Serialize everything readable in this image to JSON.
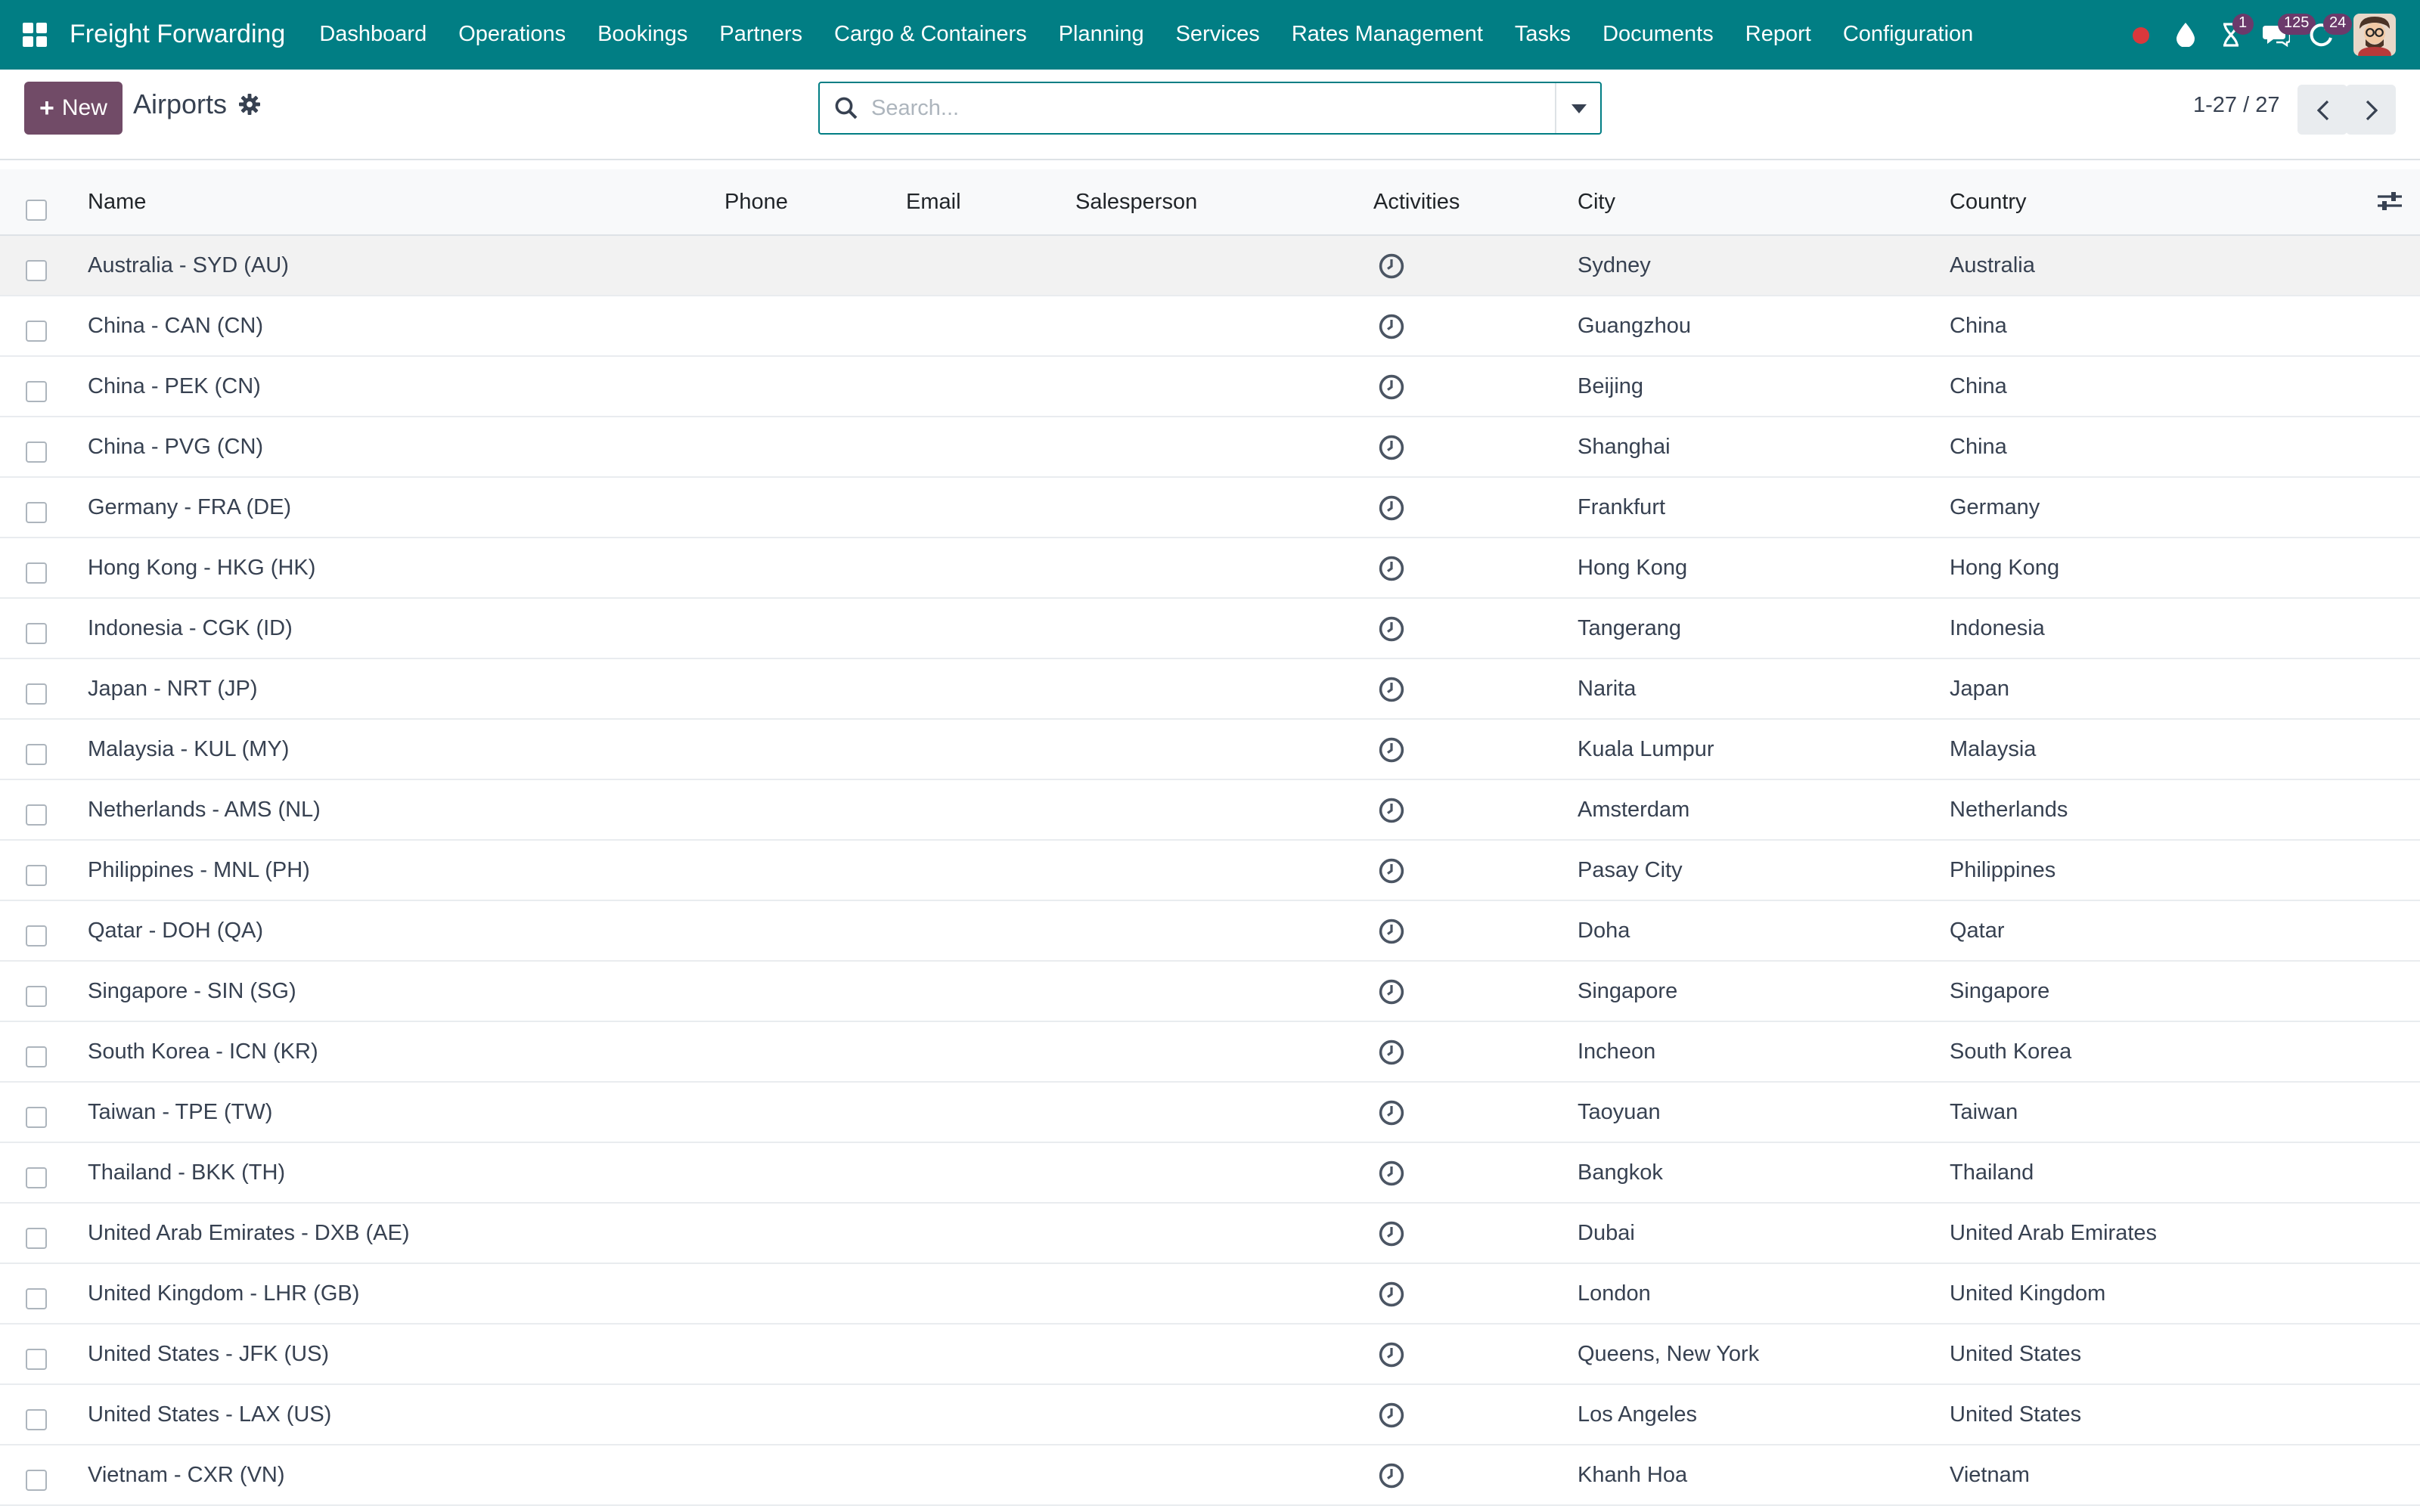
{
  "navbar": {
    "brand": "Freight Forwarding",
    "menu": [
      "Dashboard",
      "Operations",
      "Bookings",
      "Partners",
      "Cargo & Containers",
      "Planning",
      "Services",
      "Rates Management",
      "Tasks",
      "Documents",
      "Report",
      "Configuration"
    ],
    "badges": {
      "activities": "1",
      "messages": "125",
      "updates": "24"
    }
  },
  "control_panel": {
    "new_label": "New",
    "title": "Airports",
    "search_placeholder": "Search...",
    "pager": "1-27 / 27"
  },
  "table": {
    "headers": {
      "name": "Name",
      "phone": "Phone",
      "email": "Email",
      "salesperson": "Salesperson",
      "activities": "Activities",
      "city": "City",
      "country": "Country"
    },
    "rows": [
      {
        "name": "Australia - SYD (AU)",
        "phone": "",
        "email": "",
        "salesperson": "",
        "city": "Sydney",
        "country": "Australia"
      },
      {
        "name": "China - CAN (CN)",
        "phone": "",
        "email": "",
        "salesperson": "",
        "city": "Guangzhou",
        "country": "China"
      },
      {
        "name": "China - PEK (CN)",
        "phone": "",
        "email": "",
        "salesperson": "",
        "city": "Beijing",
        "country": "China"
      },
      {
        "name": "China - PVG (CN)",
        "phone": "",
        "email": "",
        "salesperson": "",
        "city": "Shanghai",
        "country": "China"
      },
      {
        "name": "Germany - FRA (DE)",
        "phone": "",
        "email": "",
        "salesperson": "",
        "city": "Frankfurt",
        "country": "Germany"
      },
      {
        "name": "Hong Kong - HKG (HK)",
        "phone": "",
        "email": "",
        "salesperson": "",
        "city": "Hong Kong",
        "country": "Hong Kong"
      },
      {
        "name": "Indonesia - CGK (ID)",
        "phone": "",
        "email": "",
        "salesperson": "",
        "city": "Tangerang",
        "country": "Indonesia"
      },
      {
        "name": "Japan - NRT (JP)",
        "phone": "",
        "email": "",
        "salesperson": "",
        "city": "Narita",
        "country": "Japan"
      },
      {
        "name": "Malaysia - KUL (MY)",
        "phone": "",
        "email": "",
        "salesperson": "",
        "city": "Kuala Lumpur",
        "country": "Malaysia"
      },
      {
        "name": "Netherlands - AMS (NL)",
        "phone": "",
        "email": "",
        "salesperson": "",
        "city": "Amsterdam",
        "country": "Netherlands"
      },
      {
        "name": "Philippines - MNL (PH)",
        "phone": "",
        "email": "",
        "salesperson": "",
        "city": "Pasay City",
        "country": "Philippines"
      },
      {
        "name": "Qatar - DOH (QA)",
        "phone": "",
        "email": "",
        "salesperson": "",
        "city": "Doha",
        "country": "Qatar"
      },
      {
        "name": "Singapore - SIN (SG)",
        "phone": "",
        "email": "",
        "salesperson": "",
        "city": "Singapore",
        "country": "Singapore"
      },
      {
        "name": "South Korea - ICN (KR)",
        "phone": "",
        "email": "",
        "salesperson": "",
        "city": "Incheon",
        "country": "South Korea"
      },
      {
        "name": "Taiwan - TPE (TW)",
        "phone": "",
        "email": "",
        "salesperson": "",
        "city": "Taoyuan",
        "country": "Taiwan"
      },
      {
        "name": "Thailand - BKK (TH)",
        "phone": "",
        "email": "",
        "salesperson": "",
        "city": "Bangkok",
        "country": "Thailand"
      },
      {
        "name": "United Arab Emirates - DXB (AE)",
        "phone": "",
        "email": "",
        "salesperson": "",
        "city": "Dubai",
        "country": "United Arab Emirates"
      },
      {
        "name": "United Kingdom - LHR (GB)",
        "phone": "",
        "email": "",
        "salesperson": "",
        "city": "London",
        "country": "United Kingdom"
      },
      {
        "name": "United States - JFK (US)",
        "phone": "",
        "email": "",
        "salesperson": "",
        "city": "Queens, New York",
        "country": "United States"
      },
      {
        "name": "United States - LAX (US)",
        "phone": "",
        "email": "",
        "salesperson": "",
        "city": "Los Angeles",
        "country": "United States"
      },
      {
        "name": "Vietnam - CXR (VN)",
        "phone": "",
        "email": "",
        "salesperson": "",
        "city": "Khanh Hoa",
        "country": "Vietnam"
      }
    ]
  },
  "colors": {
    "navbar": "#017e84",
    "primary_button": "#714b67",
    "badge": "#6b3a6b",
    "record_dot": "#d9383c"
  },
  "icons": {
    "apps": "grid-icon",
    "settings": "gear-icon",
    "search": "search-icon",
    "toggle": "caret-down-icon",
    "activity": "clock-icon",
    "optional_columns": "sliders-icon"
  }
}
